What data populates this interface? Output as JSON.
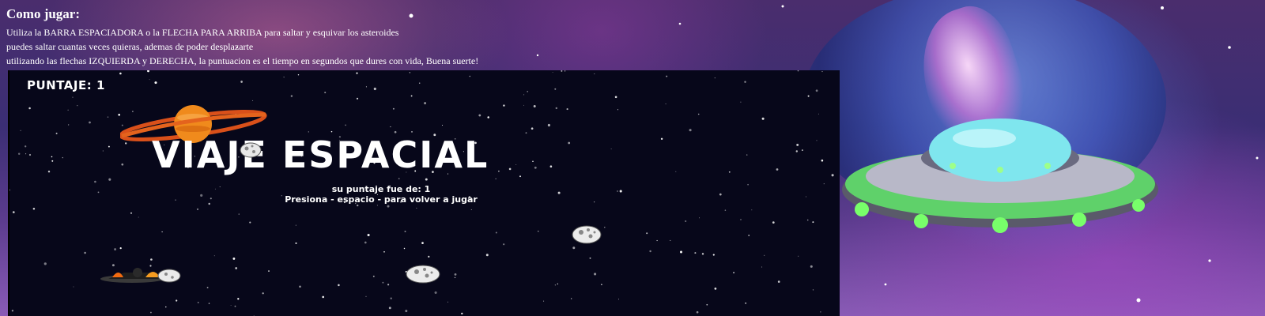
{
  "instructions": {
    "title": "Como jugar:",
    "lines": [
      "Utiliza la BARRA ESPACIADORA o la FLECHA PARA ARRIBA para saltar y esquivar los asteroides",
      "puedes saltar cuantas veces quieras, ademas de poder desplazarte",
      "utilizando las flechas IZQUIERDA y DERECHA, la puntuacion es el tiempo en segundos que dures con vida, Buena suerte!"
    ]
  },
  "game": {
    "score_label": "PUNTAJE: 1",
    "title": "VIAJE ESPACIAL",
    "final_score_text": "su puntaje fue de: 1",
    "restart_hint": "Presiona - espacio - para volver a jugar"
  },
  "icons": {
    "planet": "saturn-icon",
    "asteroid": "asteroid-icon",
    "player": "spaceship-icon",
    "ufo": "ufo-icon"
  },
  "colors": {
    "canvas_bg": "#07071a",
    "text": "#ffffff",
    "planet_orange": "#f08a1c",
    "ufo_green": "#5fd16a",
    "ufo_dome": "#7fe6ee"
  }
}
